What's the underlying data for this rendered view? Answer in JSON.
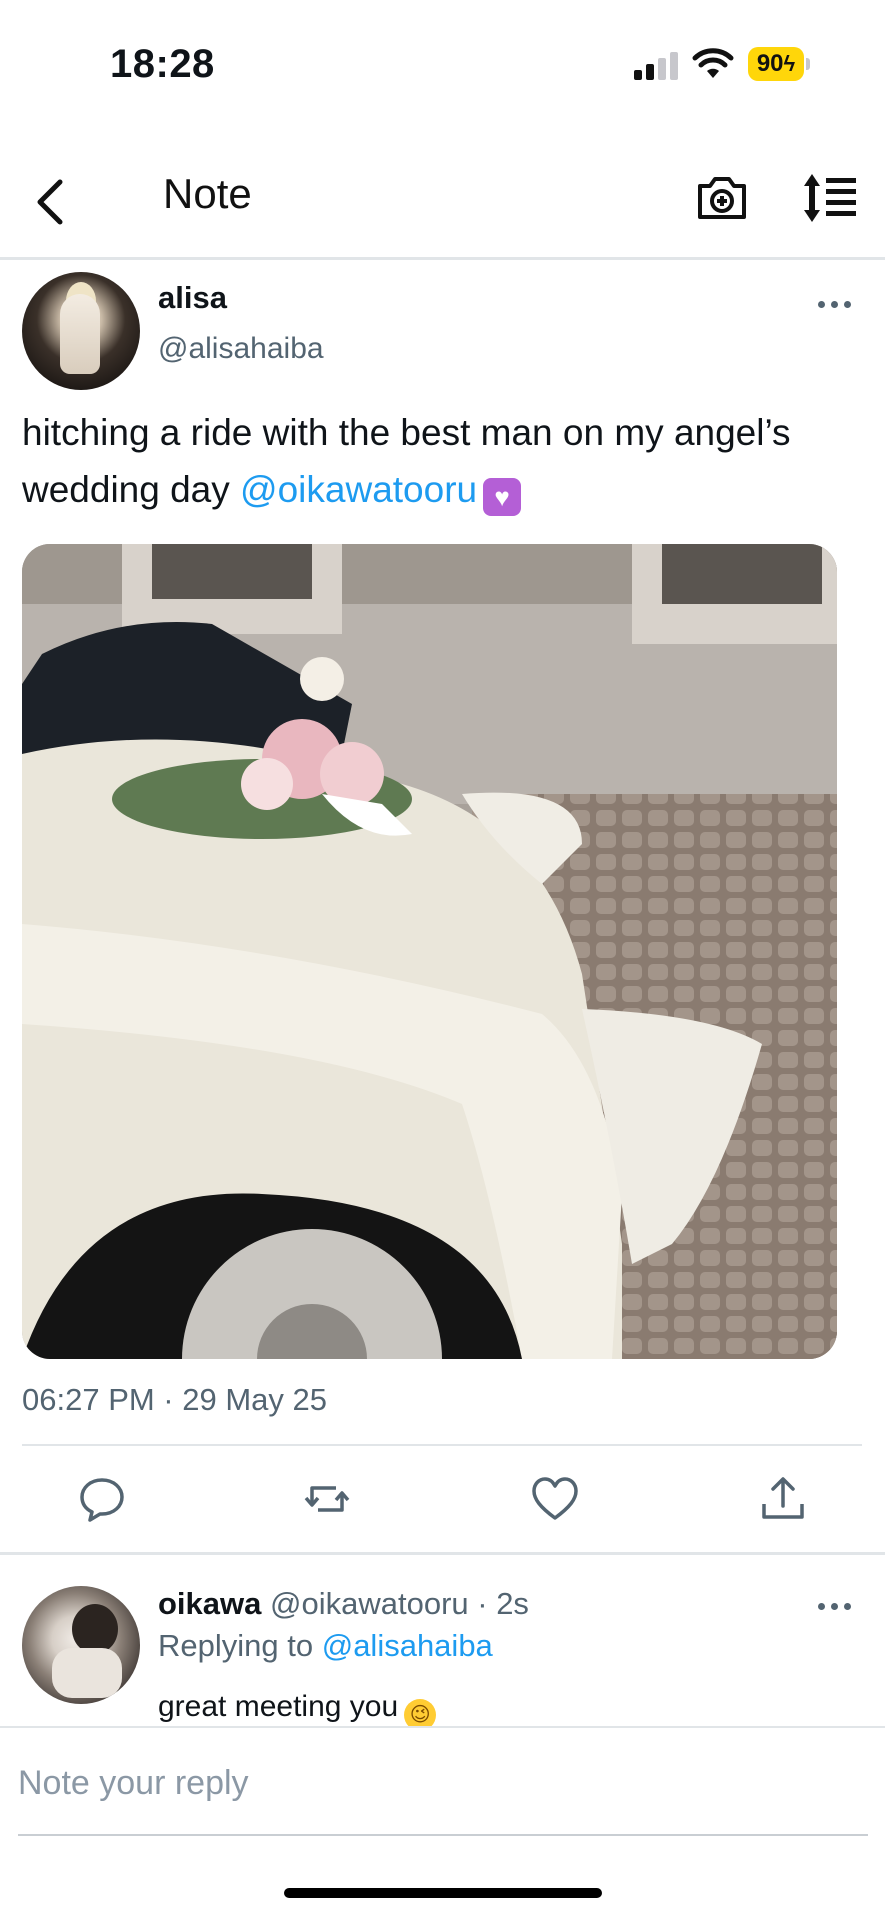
{
  "status_bar": {
    "time": "18:28",
    "battery": "90"
  },
  "nav": {
    "title": "Note",
    "icons": [
      "back-chevron-icon",
      "camera-plus-icon",
      "sort-arrows-icon"
    ]
  },
  "tweet": {
    "author_name": "alisa",
    "author_handle": "@alisahaiba",
    "text_main": "hitching a ride with the best man on my angel’s wedding day ",
    "text_mention": "@oikawatooru",
    "emoji": "💟",
    "timestamp": "06:27 PM · 29 May 25",
    "media_description_icon": "photo-icon"
  },
  "actions": {
    "icons": [
      "reply-icon",
      "retweet-icon",
      "like-icon",
      "share-icon"
    ]
  },
  "reply": {
    "author_name": "oikawa",
    "author_meta": "@oikawatooru · 2s",
    "replying_label": "Replying to ",
    "replying_handle": "@alisahaiba",
    "text": "great meeting you",
    "emoji": "😉"
  },
  "composer": {
    "placeholder": "Note your reply"
  },
  "colors": {
    "accent": "#1d9bf0",
    "secondary_text": "#536471",
    "battery": "#ffd60a"
  }
}
